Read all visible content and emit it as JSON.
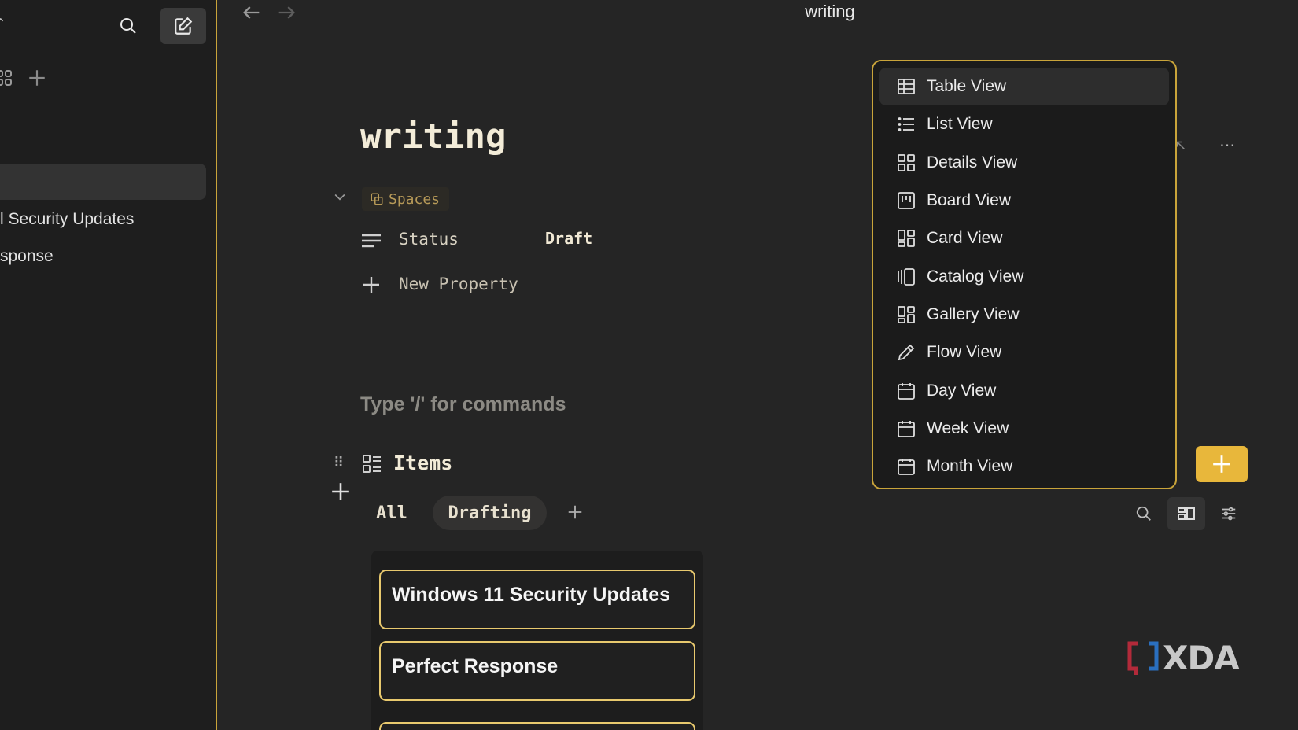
{
  "window": {
    "title": "writing"
  },
  "sidebar": {
    "items": [
      {
        "label": "l Security Updates"
      },
      {
        "label": "sponse"
      }
    ]
  },
  "page": {
    "title": "writing",
    "spaces_tag": "Spaces",
    "properties": [
      {
        "name": "Status",
        "value": "Draft"
      }
    ],
    "new_property_label": "New Property",
    "command_hint": "Type '/' for commands"
  },
  "items_block": {
    "title": "Items",
    "tabs": [
      {
        "label": "All",
        "active": false
      },
      {
        "label": "Drafting",
        "active": true
      }
    ],
    "cards": [
      {
        "title": "Windows 11 Security Updates"
      },
      {
        "title": "Perfect Response"
      },
      {
        "title": ""
      }
    ]
  },
  "view_menu": {
    "items": [
      {
        "label": "Table View",
        "icon": "table-icon",
        "active": true
      },
      {
        "label": "List View",
        "icon": "list-icon",
        "active": false
      },
      {
        "label": "Details View",
        "icon": "grid-icon",
        "active": false
      },
      {
        "label": "Board View",
        "icon": "board-icon",
        "active": false
      },
      {
        "label": "Card View",
        "icon": "card-icon",
        "active": false
      },
      {
        "label": "Catalog View",
        "icon": "catalog-icon",
        "active": false
      },
      {
        "label": "Gallery View",
        "icon": "gallery-icon",
        "active": false
      },
      {
        "label": "Flow View",
        "icon": "pencil-icon",
        "active": false
      },
      {
        "label": "Day View",
        "icon": "calendar-icon",
        "active": false
      },
      {
        "label": "Week View",
        "icon": "calendar-icon",
        "active": false
      },
      {
        "label": "Month View",
        "icon": "calendar-icon",
        "active": false
      }
    ]
  },
  "watermark": {
    "text": "XDA"
  },
  "colors": {
    "accent": "#e8b73b",
    "border_gold": "#c9a43a",
    "background": "#252525",
    "sidebar_bg": "#1e1e1e"
  }
}
